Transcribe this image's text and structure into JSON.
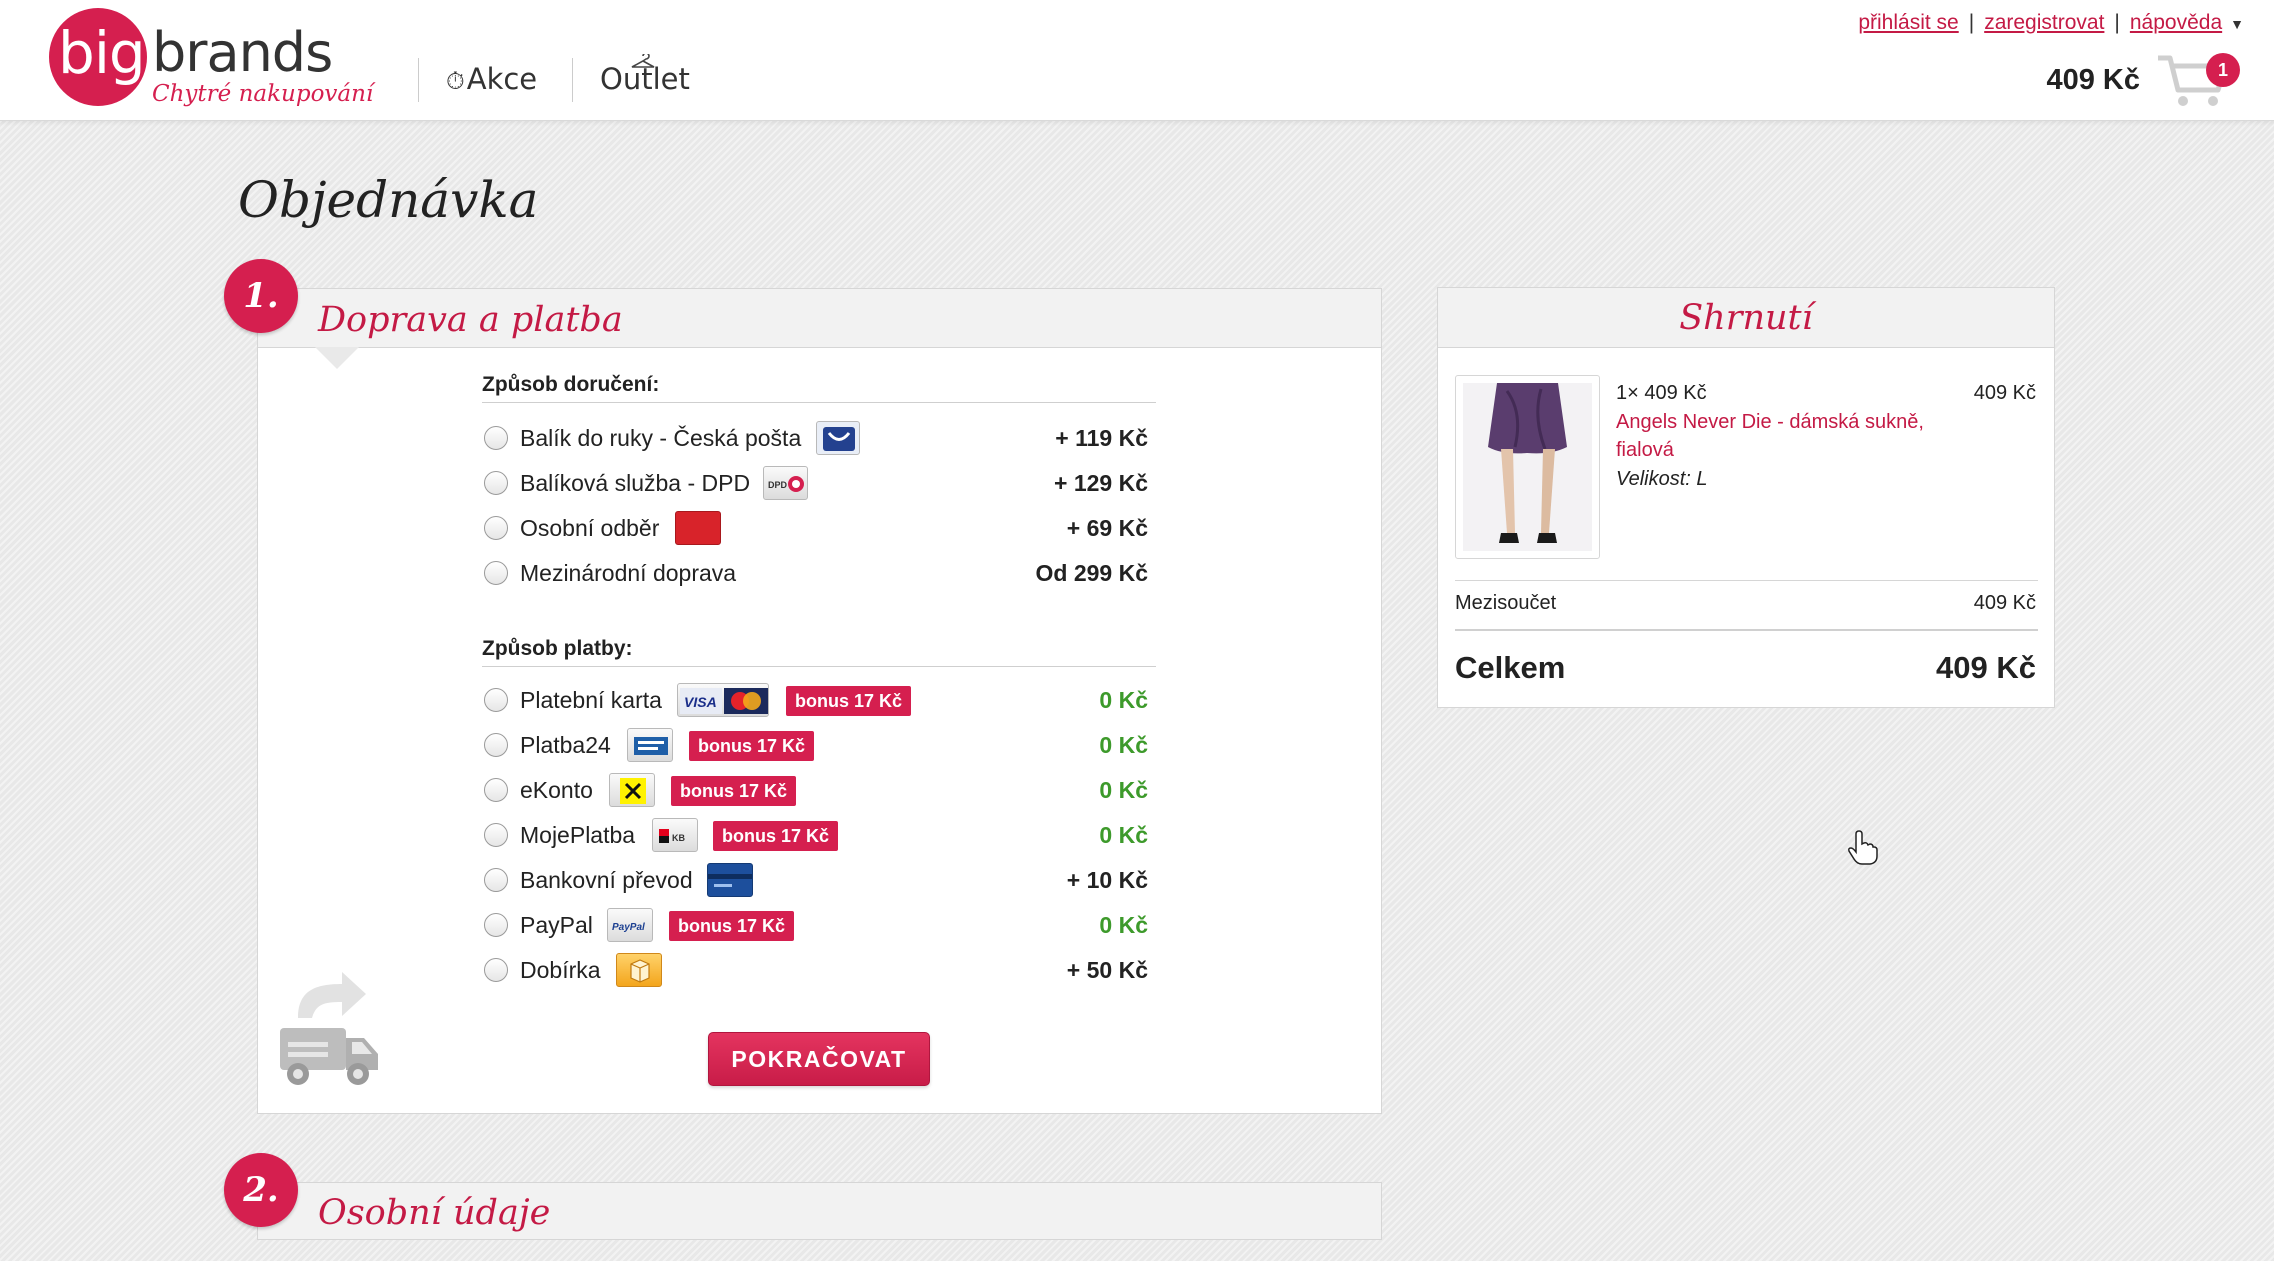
{
  "header": {
    "logo_big": "big",
    "logo_brands": "brands",
    "logo_tagline": "Chytré nakupování",
    "nav": [
      {
        "label": "Akce",
        "icon": "stopwatch-icon"
      },
      {
        "label": "Outlet",
        "icon": "hanger-icon"
      }
    ],
    "links": {
      "login": "přihlásit se",
      "register": "zaregistrovat",
      "help": "nápověda"
    },
    "cart_total": "409 Kč",
    "cart_count": "1"
  },
  "page_title": "Objednávka",
  "step1": {
    "number": "1.",
    "title": "Doprava a platba",
    "delivery_label": "Způsob doručení:",
    "delivery_options": [
      {
        "label": "Balík do ruky - Česká pošta",
        "price": "+ 119 Kč",
        "logo": "ceska-posta-logo"
      },
      {
        "label": "Balíková služba - DPD",
        "price": "+ 129 Kč",
        "logo": "dpd-logo"
      },
      {
        "label": "Osobní odběr",
        "price": "+ 69 Kč",
        "logo": "ulozenka-logo"
      },
      {
        "label": "Mezinárodní doprava",
        "price": "Od 299 Kč",
        "logo": ""
      }
    ],
    "payment_label": "Způsob platby:",
    "payment_options": [
      {
        "label": "Platební karta",
        "price": "0 Kč",
        "bonus": "bonus 17 Kč",
        "logo": "visa-mastercard-logo"
      },
      {
        "label": "Platba24",
        "price": "0 Kč",
        "bonus": "bonus 17 Kč",
        "logo": "ceska-sporitelna-logo"
      },
      {
        "label": "eKonto",
        "price": "0 Kč",
        "bonus": "bonus 17 Kč",
        "logo": "raiffeisen-logo"
      },
      {
        "label": "MojePlatba",
        "price": "0 Kč",
        "bonus": "bonus 17 Kč",
        "logo": "kb-logo"
      },
      {
        "label": "Bankovní převod",
        "price": "+ 10 Kč",
        "bonus": "",
        "logo": "bank-card-logo"
      },
      {
        "label": "PayPal",
        "price": "0 Kč",
        "bonus": "bonus 17 Kč",
        "logo": "paypal-logo"
      },
      {
        "label": "Dobírka",
        "price": "+ 50 Kč",
        "bonus": "",
        "logo": "package-logo"
      }
    ],
    "continue_button": "POKRAČOVAT"
  },
  "step2": {
    "number": "2.",
    "title": "Osobní údaje"
  },
  "summary": {
    "title": "Shrnutí",
    "item": {
      "qty_price": "1× 409 Kč",
      "price": "409 Kč",
      "name": "Angels Never Die - dámská sukně, fialová",
      "size": "Velikost: L"
    },
    "subtotal_label": "Mezisoučet",
    "subtotal_value": "409 Kč",
    "total_label": "Celkem",
    "total_value": "409 Kč"
  },
  "colors": {
    "brand": "#d51f4f",
    "link": "#c41a45",
    "free_price": "#3d9a2b"
  }
}
